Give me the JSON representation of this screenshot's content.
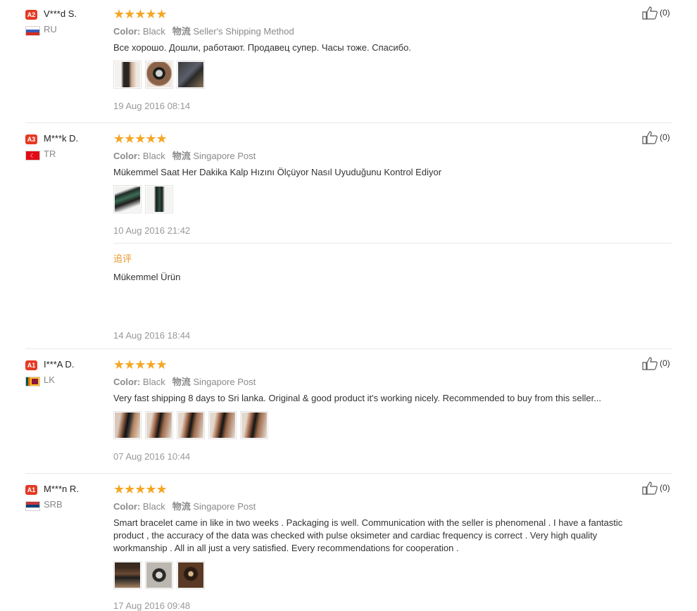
{
  "reviews": [
    {
      "level": "A2",
      "user": "V***d S.",
      "country": "RU",
      "stars": "★★★★★",
      "color_label": "Color:",
      "color_value": "Black",
      "shipping_label": "物流",
      "shipping_value": "Seller's Shipping Method",
      "text": "Все хорошо. Дошли, работают. Продавец супер. Часы тоже. Спасибо.",
      "date": "19 Aug 2016 08:14",
      "likes": "(0)"
    },
    {
      "level": "A3",
      "user": "M***k D.",
      "country": "TR",
      "stars": "★★★★★",
      "color_label": "Color:",
      "color_value": "Black",
      "shipping_label": "物流",
      "shipping_value": "Singapore Post",
      "text": "Mükemmel Saat Her Dakika Kalp Hızını Ölçüyor Nasıl Uyuduğunu Kontrol Ediyor",
      "date": "10 Aug 2016 21:42",
      "likes": "(0)",
      "additional_label": "追评",
      "additional_text": "Mükemmel Ürün",
      "additional_date": "14 Aug 2016 18:44"
    },
    {
      "level": "A1",
      "user": "I***A D.",
      "country": "LK",
      "stars": "★★★★★",
      "color_label": "Color:",
      "color_value": "Black",
      "shipping_label": "物流",
      "shipping_value": "Singapore Post",
      "text": "Very fast shipping 8 days to Sri lanka. Original & good product it's working nicely. Recommended to buy from this seller...",
      "date": "07 Aug 2016 10:44",
      "likes": "(0)"
    },
    {
      "level": "A1",
      "user": "M***n R.",
      "country": "SRB",
      "stars": "★★★★★",
      "color_label": "Color:",
      "color_value": "Black",
      "shipping_label": "物流",
      "shipping_value": "Singapore Post",
      "text": "Smart bracelet came in like in two weeks . Packaging is well. Communication with the seller is phenomenal . I have a fantastic product , the accuracy of the data was checked with pulse oksimeter and cardiac frequency is correct . Very high quality workmanship . All in all just a very satisfied. Every recommendations for cooperation .",
      "date": "17 Aug 2016 09:48",
      "likes": "(0)"
    }
  ],
  "colors": {
    "level_badge": "#e43a24",
    "stars": "#f5a623",
    "additional_label": "#e7962b"
  },
  "icons": {
    "like": "thumbs-up-icon",
    "star": "star-icon"
  }
}
